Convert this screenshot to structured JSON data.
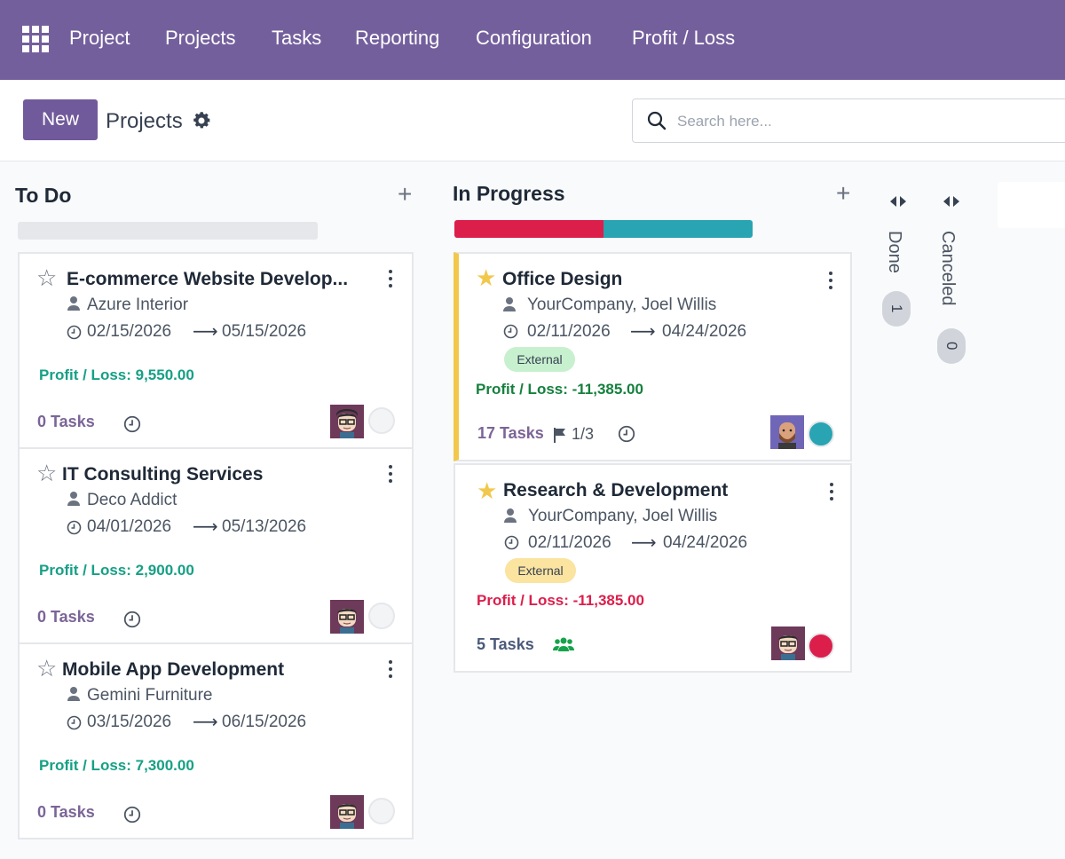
{
  "nav": {
    "app_name": "Project",
    "menu": [
      "Projects",
      "Tasks",
      "Reporting",
      "Configuration",
      "Profit / Loss"
    ]
  },
  "control": {
    "new_label": "New",
    "breadcrumb": "Projects",
    "search_placeholder": "Search here..."
  },
  "columns": {
    "todo": {
      "title": "To Do"
    },
    "in_progress": {
      "title": "In Progress"
    },
    "done": {
      "title": "Done",
      "count": "1"
    },
    "canceled": {
      "title": "Canceled",
      "count": "0"
    }
  },
  "cards": [
    {
      "title": "E-commerce Website Develop...",
      "customer": "Azure Interior",
      "start": "02/15/2026",
      "end": "05/15/2026",
      "profit": "Profit / Loss: 9,550.00",
      "tasks": "0 Tasks"
    },
    {
      "title": "IT Consulting Services",
      "customer": "Deco Addict",
      "start": "04/01/2026",
      "end": "05/13/2026",
      "profit": "Profit / Loss: 2,900.00",
      "tasks": "0 Tasks"
    },
    {
      "title": "Mobile App Development",
      "customer": "Gemini Furniture",
      "start": "03/15/2026",
      "end": "06/15/2026",
      "profit": "Profit / Loss: 7,300.00",
      "tasks": "0 Tasks"
    },
    {
      "title": "Office Design",
      "customer": "YourCompany, Joel Willis",
      "start": "02/11/2026",
      "end": "04/24/2026",
      "tag": "External",
      "profit": "Profit / Loss: -11,385.00",
      "tasks": "17  Tasks",
      "milestones": "1/3"
    },
    {
      "title": "Research & Development",
      "customer": "YourCompany, Joel Willis",
      "start": "02/11/2026",
      "end": "04/24/2026",
      "tag": "External",
      "profit": "Profit / Loss: -11,385.00",
      "tasks": "5  Tasks"
    }
  ],
  "colors": {
    "navbar": "#745f9d",
    "primary": "#715a9b",
    "profit_positive_todo": "#16a085",
    "profit_positive": "#15803d",
    "profit_negative": "#dc1e4b",
    "progress_red": "#dc1e4b",
    "progress_teal": "#28a4b2",
    "star_favorite": "#f2c84c"
  },
  "icons": [
    "apps-grid-icon",
    "gear-icon",
    "search-icon",
    "star-icon",
    "kebab-icon",
    "person-icon",
    "clock-icon",
    "flag-icon",
    "users-icon",
    "fold-arrows-icon",
    "plus-icon"
  ]
}
